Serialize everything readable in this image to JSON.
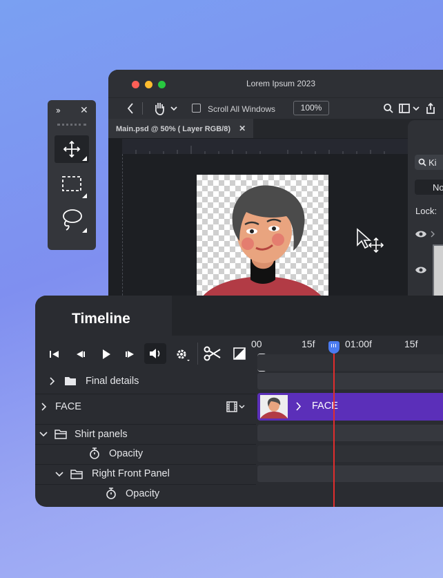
{
  "window": {
    "title": "Lorem Ipsum 2023",
    "toolbar": {
      "scroll_all_windows": "Scroll All Windows",
      "zoom": "100%"
    },
    "doc_tab": "Main.psd @ 50% ( Layer RGB/8)",
    "layers_panel": {
      "search_text": "Ki",
      "blend_button": "No",
      "lock_label": "Lock:"
    }
  },
  "timeline": {
    "title": "Timeline",
    "ruler": [
      "00",
      "15f",
      "01:00f",
      "15f"
    ],
    "rows": [
      {
        "label": "Final details"
      },
      {
        "label": "FACE"
      },
      {
        "label": "Shirt panels"
      },
      {
        "label": "Opacity"
      },
      {
        "label": "Right Front Panel"
      },
      {
        "label": "Opacity"
      }
    ],
    "clip_label": "FACE"
  },
  "colors": {
    "accent": "#5b2fb9",
    "playhead": "#e12d2d",
    "handle": "#4a7bf0"
  }
}
